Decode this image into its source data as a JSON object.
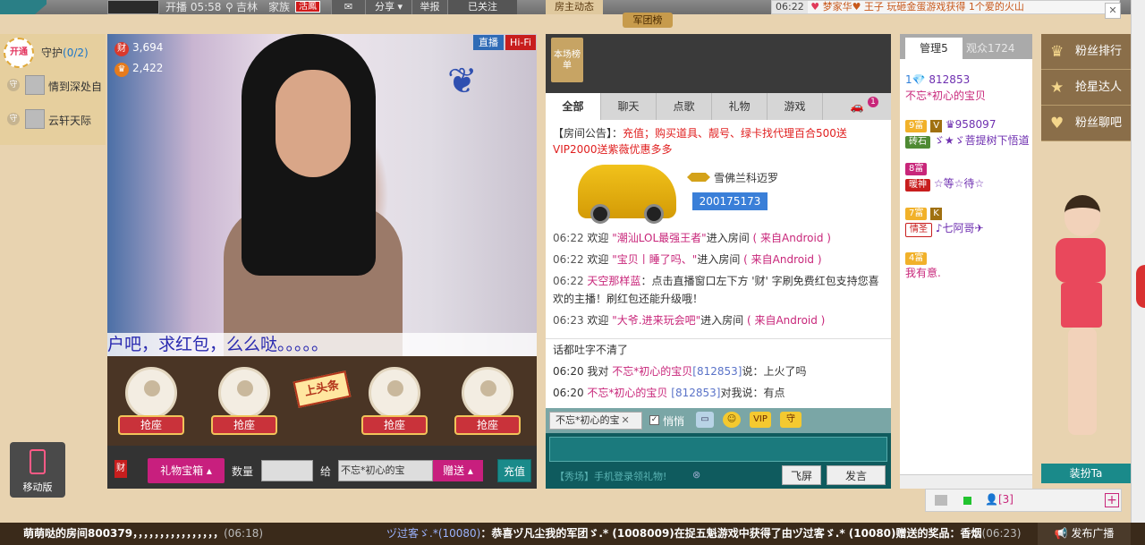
{
  "topbar": {
    "start_time": "开播 05:58",
    "location": "吉林",
    "family": "家族",
    "badge": "活鳳",
    "share": "分享",
    "report": "举报",
    "followed": "已关注",
    "room_dynamic": "房主动态",
    "legion": "军团榜",
    "ticker_time": "06:22",
    "ticker_msg": "梦家华♥ 王子 玩砸金蛋游戏获得 1个爱的火山"
  },
  "guard": {
    "open_label": "开通",
    "title": "守护",
    "count": "(0/2)",
    "members": [
      {
        "icon": "守",
        "name": "情到深处自"
      },
      {
        "icon": "守",
        "name": "云轩天际"
      }
    ]
  },
  "mobile_label": "移动版",
  "video": {
    "wealth_icon": "财",
    "wealth": "3,694",
    "fans": "2,422",
    "live_label": "直播",
    "hifi_label": "Hi-Fi",
    "caption": "户吧，求红包，么么哒。。。。。"
  },
  "seats": {
    "grab_label": "抢座",
    "headline_label": "上头条"
  },
  "giftbar": {
    "cai": "财",
    "gift_box": "礼物宝箱",
    "quantity_label": "数量",
    "give_label": "给",
    "recipient": "不忘*初心的宝",
    "send_label": "赠送",
    "recharge_label": "充值"
  },
  "rank": {
    "tag": "本场榜单"
  },
  "tabs": [
    "全部",
    "聊天",
    "点歌",
    "礼物",
    "游戏"
  ],
  "tab_badge": "1",
  "chat": {
    "notice_prefix": "【房间公告】：",
    "notice_body": "充值；购买道具、靓号、绿卡找代理百合500送VIP2000送紫薇优惠多多",
    "car_name": "雪佛兰科迈罗",
    "car_id": "200175173",
    "messages": [
      {
        "time": "06:22",
        "pre": "欢迎",
        "user": "\"潮汕LOL最强王者\"",
        "action": "进入房间",
        "source": "( 来自Android )"
      },
      {
        "time": "06:22",
        "pre": "欢迎",
        "user": "\"宝贝丨睡了吗、\"",
        "action": "进入房间",
        "source": "( 来自Android )"
      },
      {
        "time": "06:22",
        "user": "天空那样蓝",
        "text": "：点击直播窗口左下方 '财' 字刷免费红包支持您喜欢的主播！刷红包还能升级哦！"
      },
      {
        "time": "06:23",
        "pre": "欢迎",
        "user": "\"大爷.进来玩会吧\"",
        "action": "进入房间",
        "source": "( 来自Android )"
      }
    ]
  },
  "chat2": {
    "line0": "话都吐字不清了",
    "m1": {
      "time": "06:20",
      "pre": "我对",
      "user": "不忘*初心的宝贝",
      "id": "[812853]",
      "text": "说：上火了吗"
    },
    "m2": {
      "time": "06:20",
      "user": "不忘*初心的宝贝",
      "id": "[812853]",
      "text": "对我说：有点"
    }
  },
  "inputbar": {
    "target": "不忘*初心的宝",
    "whisper": "悄悄",
    "vip": "VIP"
  },
  "inputbox": {
    "ad": "【秀场】手机登录领礼物!",
    "fly": "飞屏",
    "send": "发言"
  },
  "users": {
    "tab_admin": "管理5",
    "tab_audience": "观众1724",
    "rows": [
      {
        "id": "812853",
        "name": "不忘*初心的宝贝"
      },
      {
        "rich": "9富",
        "name": "958097"
      },
      {
        "tag": "砖石",
        "name": "ゞ★ゞ菩提树下悟道"
      },
      {
        "rich": "8富",
        "name": ""
      },
      {
        "tag": "暖神",
        "name": "☆等☆待☆"
      },
      {
        "rich": "7富",
        "name": ""
      },
      {
        "tag": "情圣",
        "name": "♪七阿哥✈"
      },
      {
        "rich": "4富",
        "name": ""
      },
      {
        "name": "我有意."
      }
    ]
  },
  "rightbtns": [
    {
      "icon": "♛",
      "label": "粉丝排行"
    },
    {
      "icon": "★",
      "label": "抢星达人"
    },
    {
      "icon": "♥",
      "label": "粉丝聊吧"
    }
  ],
  "dress_label": "装扮Ta",
  "ctrlbar": {
    "people": "[3]"
  },
  "bottom": {
    "m1": "萌萌哒的房间800379，，，，，，，，，，，，，，，，",
    "t1": "(06:18)",
    "m2_user": "ヅ过客ゞ.*(10080)",
    "m2": "：恭喜ヅ凡尘我的军团ゞ.* (1008009)在捉五魁游戏中获得了由ヅ过客ゞ.* (10080)赠送的奖品：香烟",
    "t2": "(06:23)",
    "broadcast": "发布广播"
  }
}
